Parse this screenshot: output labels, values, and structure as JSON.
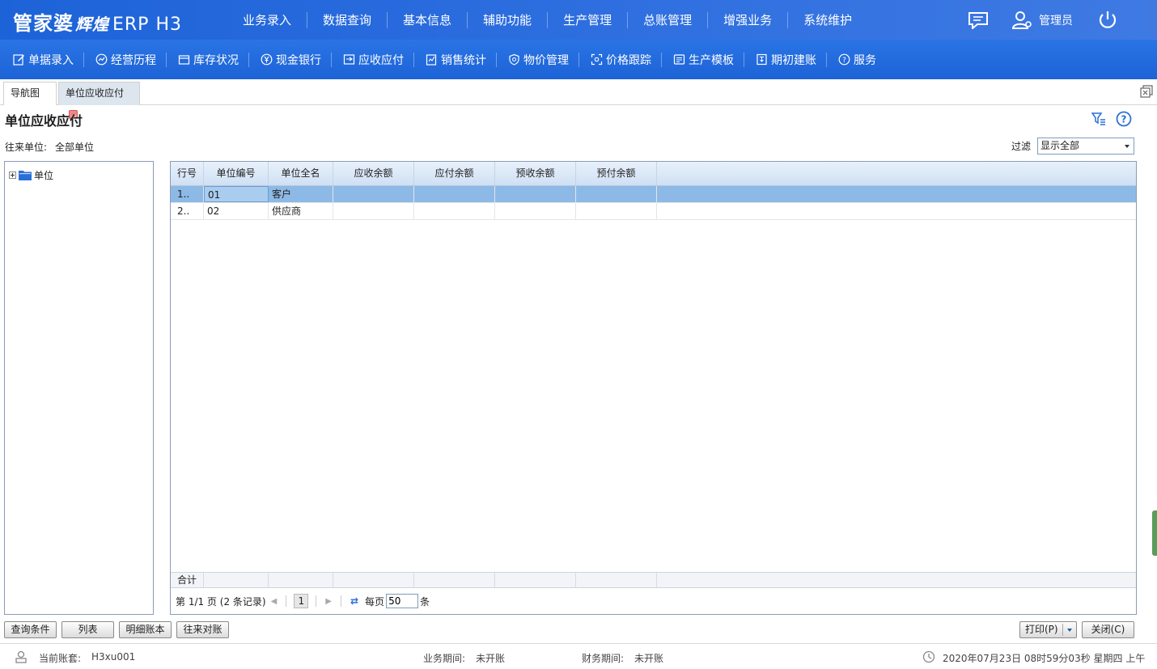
{
  "header": {
    "logo_main": "管家婆",
    "logo_sub": "辉煌",
    "logo_ver": "ERP H3",
    "nav": [
      "业务录入",
      "数据查询",
      "基本信息",
      "辅助功能",
      "生产管理",
      "总账管理",
      "增强业务",
      "系统维护"
    ],
    "user": "管理员"
  },
  "toolbar": {
    "items": [
      "单据录入",
      "经营历程",
      "库存状况",
      "现金银行",
      "应收应付",
      "销售统计",
      "物价管理",
      "价格跟踪",
      "生产模板",
      "期初建账",
      "服务"
    ]
  },
  "tabs": {
    "nav": "导航图",
    "active": "单位应收应付"
  },
  "page": {
    "title": "单位应收应付",
    "unit_label": "往来单位:",
    "unit_value": "全部单位",
    "filter_label": "过滤",
    "filter_value": "显示全部"
  },
  "tree": {
    "root": "单位"
  },
  "grid": {
    "columns": [
      "行号",
      "单位编号",
      "单位全名",
      "应收余额",
      "应付余额",
      "预收余额",
      "预付余额"
    ],
    "rows": [
      {
        "no": "1..",
        "code": "01",
        "name": "客户"
      },
      {
        "no": "2..",
        "code": "02",
        "name": "供应商"
      }
    ],
    "footer_label": "合计"
  },
  "pager": {
    "info": "第 1/1 页 (2 条记录)",
    "current": "1",
    "per_page_label": "每页",
    "per_page": "50",
    "unit": "条"
  },
  "buttons": {
    "query": "查询条件",
    "list": "列表",
    "detail": "明细账本",
    "reconcile": "往来对账",
    "print": "打印(P)",
    "close": "关闭(C)"
  },
  "status": {
    "account_label": "当前账套:",
    "account_value": "H3xu001",
    "biz_label": "业务期间:",
    "biz_value": "未开账",
    "fin_label": "财务期间:",
    "fin_value": "未开账",
    "datetime": "2020年07月23日 08时59分03秒 星期四 上午"
  }
}
